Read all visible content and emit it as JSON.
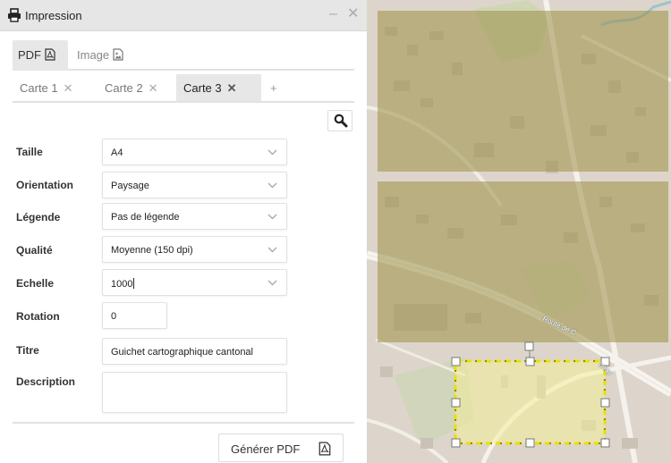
{
  "window": {
    "title": "Impression",
    "minimize": "–",
    "close": "✕"
  },
  "format_tabs": [
    {
      "label": "PDF",
      "icon": "pdf-file-icon",
      "active": true
    },
    {
      "label": "Image",
      "icon": "image-file-icon",
      "active": false
    }
  ],
  "map_tabs": [
    {
      "label": "Carte 1",
      "close": "✕",
      "active": false
    },
    {
      "label": "Carte 2",
      "close": "✕",
      "active": false
    },
    {
      "label": "Carte 3",
      "close": "✕",
      "active": true
    }
  ],
  "add_tab": "+",
  "fields": {
    "taille": {
      "label": "Taille",
      "value": "A4"
    },
    "orientation": {
      "label": "Orientation",
      "value": "Paysage"
    },
    "legende": {
      "label": "Légende",
      "value": "Pas de légende"
    },
    "qualite": {
      "label": "Qualité",
      "value": "Moyenne (150 dpi)"
    },
    "echelle": {
      "label": "Echelle",
      "value": "1000"
    },
    "rotation": {
      "label": "Rotation",
      "value": "0"
    },
    "titre": {
      "label": "Titre",
      "value": "Guichet cartographique cantonal"
    },
    "description": {
      "label": "Description",
      "value": ""
    }
  },
  "generate_button": {
    "label": "Générer PDF",
    "icon": "pdf-file-icon"
  },
  "map": {
    "street_label_1": "Route de C",
    "street_label_2": "onay",
    "print_extent_color": "#e8e000",
    "overlay_color": "#9a8f45"
  },
  "colors": {
    "accent_tab": "#e7e7e7",
    "titlebar": "#e6e6e6"
  }
}
